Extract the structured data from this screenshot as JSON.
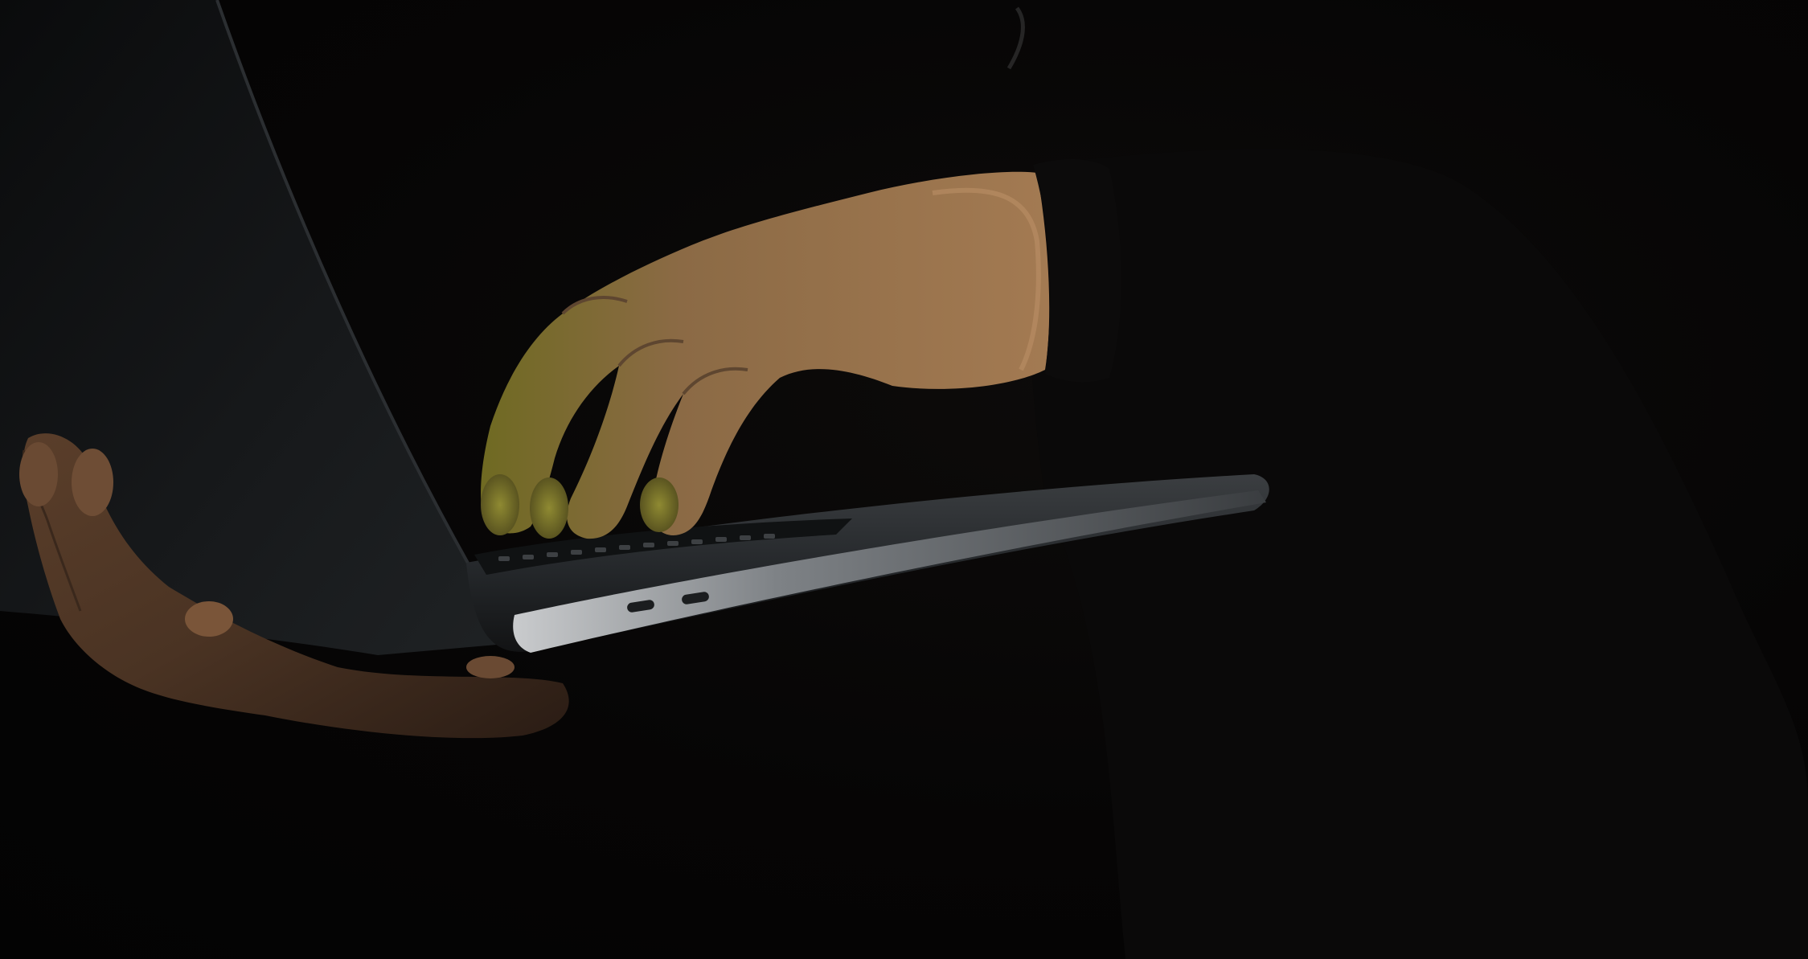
{
  "scene": {
    "subject": "person-typing-on-laptop-in-dark",
    "colors": {
      "background": "#050404",
      "skin": "#8a6444",
      "skin_highlight": "#b58a60",
      "finger_glow": "#7d7a2a",
      "laptop_body": "#2a2c2e",
      "laptop_edge": "#8c8f93",
      "sleeve": "#0b0a0a"
    }
  }
}
